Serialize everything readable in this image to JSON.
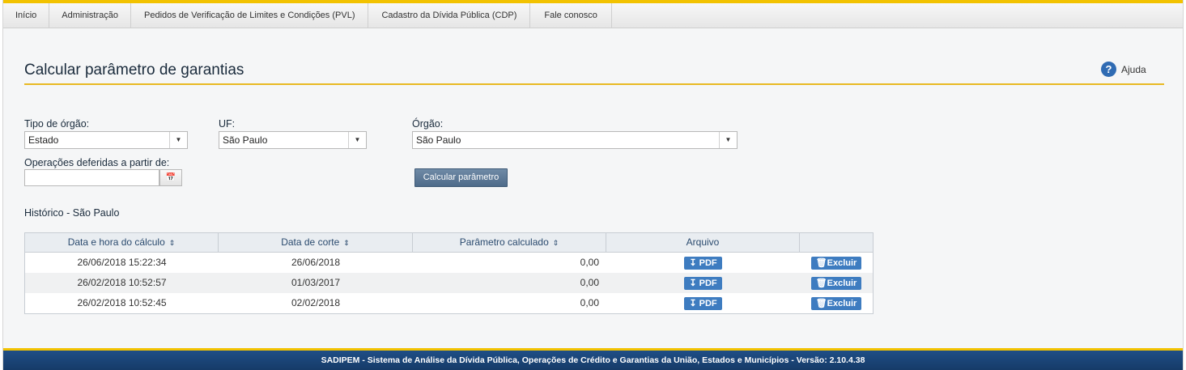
{
  "nav": {
    "items": [
      {
        "label": "Início"
      },
      {
        "label": "Administração"
      },
      {
        "label": "Pedidos de Verificação de Limites e Condições (PVL)"
      },
      {
        "label": "Cadastro da Dívida Pública (CDP)"
      },
      {
        "label": "Fale conosco"
      }
    ]
  },
  "page": {
    "title": "Calcular parâmetro de garantias",
    "help_label": "Ajuda",
    "help_icon": "question-circle-icon",
    "accent_color": "#e8b923"
  },
  "form": {
    "tipo_orgao": {
      "label": "Tipo de órgão:",
      "value": "Estado"
    },
    "uf": {
      "label": "UF:",
      "value": "São Paulo"
    },
    "orgao": {
      "label": "Órgão:",
      "value": "São Paulo"
    },
    "operacoes": {
      "label": "Operações deferidas a partir de:",
      "value": ""
    },
    "calc_button": "Calcular parâmetro"
  },
  "history": {
    "title": "Histórico - São Paulo",
    "columns": [
      "Data e hora do cálculo",
      "Data de corte",
      "Parâmetro calculado",
      "Arquivo",
      ""
    ],
    "rows": [
      {
        "datetime": "26/06/2018 15:22:34",
        "cutoff": "26/06/2018",
        "param": "0,00",
        "file_label": "PDF",
        "delete_label": "Excluir"
      },
      {
        "datetime": "26/02/2018 10:52:57",
        "cutoff": "01/03/2017",
        "param": "0,00",
        "file_label": "PDF",
        "delete_label": "Excluir"
      },
      {
        "datetime": "26/02/2018 10:52:45",
        "cutoff": "02/02/2018",
        "param": "0,00",
        "file_label": "PDF",
        "delete_label": "Excluir"
      }
    ]
  },
  "footer": {
    "text": "SADIPEM - Sistema de Análise da Dívida Pública, Operações de Crédito e Garantias da União, Estados e Municípios - Versão: 2.10.4.38"
  }
}
